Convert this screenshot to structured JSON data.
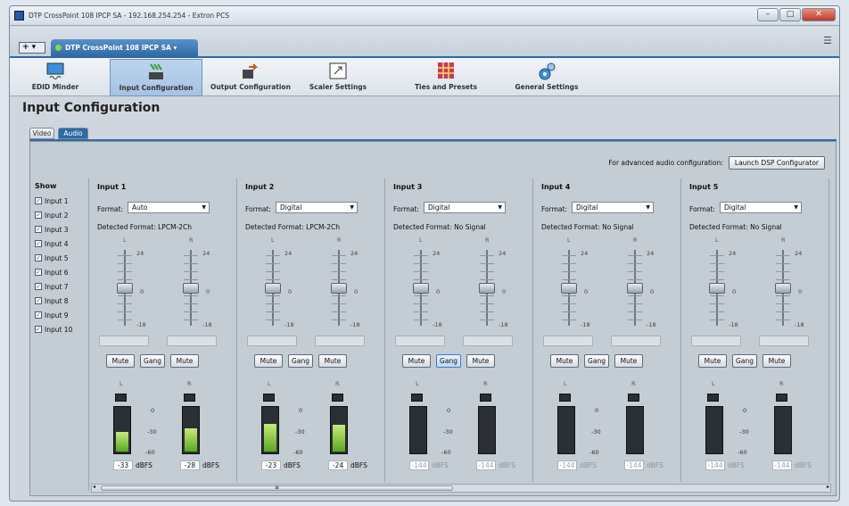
{
  "window": {
    "title": "DTP CrossPoint 108 IPCP SA - 192.168.254.254 - Extron PCS",
    "controls": [
      "minimize",
      "maximize",
      "close"
    ]
  },
  "tabs": {
    "add_label": "+ ▾",
    "device_tab": "DTP CrossPoint 108 IPCP SA ▾"
  },
  "toolbar": {
    "items": [
      {
        "label": "EDID Minder",
        "icon": "monitor-edid-icon"
      },
      {
        "label": "Input Configuration",
        "icon": "input-config-icon",
        "active": true
      },
      {
        "label": "Output Configuration",
        "icon": "output-config-icon"
      },
      {
        "label": "Scaler Settings",
        "icon": "scaler-icon"
      },
      {
        "label": "Ties and Presets",
        "icon": "grid-icon"
      },
      {
        "label": "General Settings",
        "icon": "gears-icon"
      }
    ]
  },
  "page": {
    "title": "Input Configuration",
    "subtabs": [
      "Video",
      "Audio"
    ],
    "active_subtab": "Audio",
    "advanced_text": "For advanced audio configuration:",
    "dsp_button": "Launch DSP Configurator"
  },
  "show": {
    "header": "Show",
    "items": [
      "Input 1",
      "Input 2",
      "Input 3",
      "Input 4",
      "Input 5",
      "Input 6",
      "Input 7",
      "Input 8",
      "Input 9",
      "Input 10"
    ]
  },
  "labels": {
    "format": "Format:",
    "detected": "Detected Format:",
    "left": "L",
    "right": "R",
    "mute": "Mute",
    "gang": "Gang",
    "dbfs": "dBFS",
    "fader_top": "24",
    "fader_mid": "0",
    "fader_bot": "-18",
    "meter_top": "0",
    "meter_mid": "-30",
    "meter_bot": "-60"
  },
  "inputs": [
    {
      "title": "Input 1",
      "format": "Auto",
      "detected": "LPCM-2Ch",
      "left_dbfs": "-33",
      "right_dbfs": "-28",
      "left_level": 0.45,
      "right_level": 0.53,
      "gang_selected": false
    },
    {
      "title": "Input 2",
      "format": "Digital",
      "detected": "LPCM-2Ch",
      "left_dbfs": "-23",
      "right_dbfs": "-24",
      "left_level": 0.62,
      "right_level": 0.6,
      "gang_selected": false
    },
    {
      "title": "Input 3",
      "format": "Digital",
      "detected": "No Signal",
      "left_dbfs": "-144",
      "right_dbfs": "-144",
      "left_level": 0,
      "right_level": 0,
      "gang_selected": true
    },
    {
      "title": "Input 4",
      "format": "Digital",
      "detected": "No Signal",
      "left_dbfs": "-144",
      "right_dbfs": "-144",
      "left_level": 0,
      "right_level": 0,
      "gang_selected": false
    },
    {
      "title": "Input 5",
      "format": "Digital",
      "detected": "No Signal",
      "left_dbfs": "-144",
      "right_dbfs": "-144",
      "left_level": 0,
      "right_level": 0,
      "gang_selected": false
    }
  ],
  "colors": {
    "accent": "#2e6aa6",
    "meter_green": "#5aa81e"
  }
}
